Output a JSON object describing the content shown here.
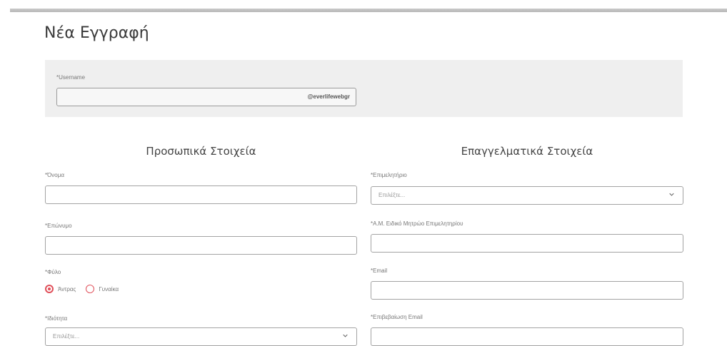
{
  "page": {
    "title": "Νέα Εγγραφή"
  },
  "username": {
    "label": "*Username",
    "suffix": "@everlifewebgr",
    "value": ""
  },
  "personal": {
    "heading": "Προσωπικά Στοιχεία",
    "first_name": {
      "label": "*Όνομα",
      "value": ""
    },
    "last_name": {
      "label": "*Επώνυμο",
      "value": ""
    },
    "gender": {
      "label": "*Φύλο",
      "options": [
        "Άντρας",
        "Γυναίκα"
      ],
      "selected": "Άντρας"
    },
    "specialty": {
      "label": "*Ιδιότητα",
      "selected": "Επιλέξτε..."
    }
  },
  "professional": {
    "heading": "Επαγγελματικά Στοιχεία",
    "chamber": {
      "label": "*Επιμελητήριο",
      "selected": "Επιλέξτε..."
    },
    "registry_id": {
      "label": "*Α.Μ. Ειδικό Μητρώο Επιμελητηρίου",
      "value": ""
    },
    "email": {
      "label": "*Email",
      "value": ""
    },
    "email_confirm": {
      "label": "*Επιβεβαίωση Email",
      "value": ""
    }
  },
  "icons": {
    "chevron": "chevron-down-icon"
  },
  "colors": {
    "accent": "#e0505a",
    "panel": "#efefef",
    "border": "#a3a3a3"
  }
}
